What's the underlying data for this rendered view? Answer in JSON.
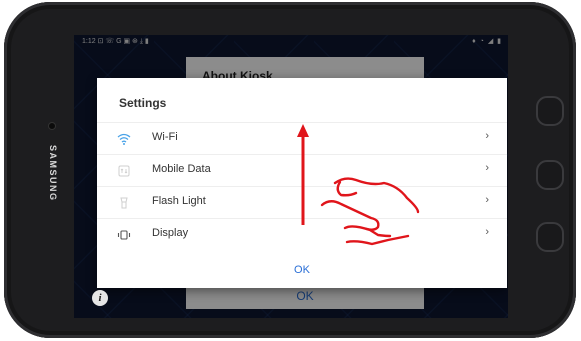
{
  "device": {
    "brand": "SAMSUNG"
  },
  "status_bar": {
    "left": "1:12 ⊡ ☏ G ▣ ⊛ ⤓ ▮",
    "right": "♦ ◔ ◢ ▮"
  },
  "background_dialog": {
    "title": "About Kiosk",
    "ok_label": "OK"
  },
  "settings_dialog": {
    "title": "Settings",
    "items": [
      {
        "label": "Wi-Fi",
        "icon": "wifi-icon",
        "chevron": "›"
      },
      {
        "label": "Mobile Data",
        "icon": "mobile-data-icon",
        "chevron": "›"
      },
      {
        "label": "Flash Light",
        "icon": "flashlight-icon",
        "chevron": "›"
      },
      {
        "label": "Display",
        "icon": "display-icon",
        "chevron": "›"
      }
    ],
    "ok_label": "OK"
  },
  "info_button": {
    "label": "i"
  },
  "colors": {
    "accent": "#2a6fd6",
    "annotation": "#e0151b"
  }
}
